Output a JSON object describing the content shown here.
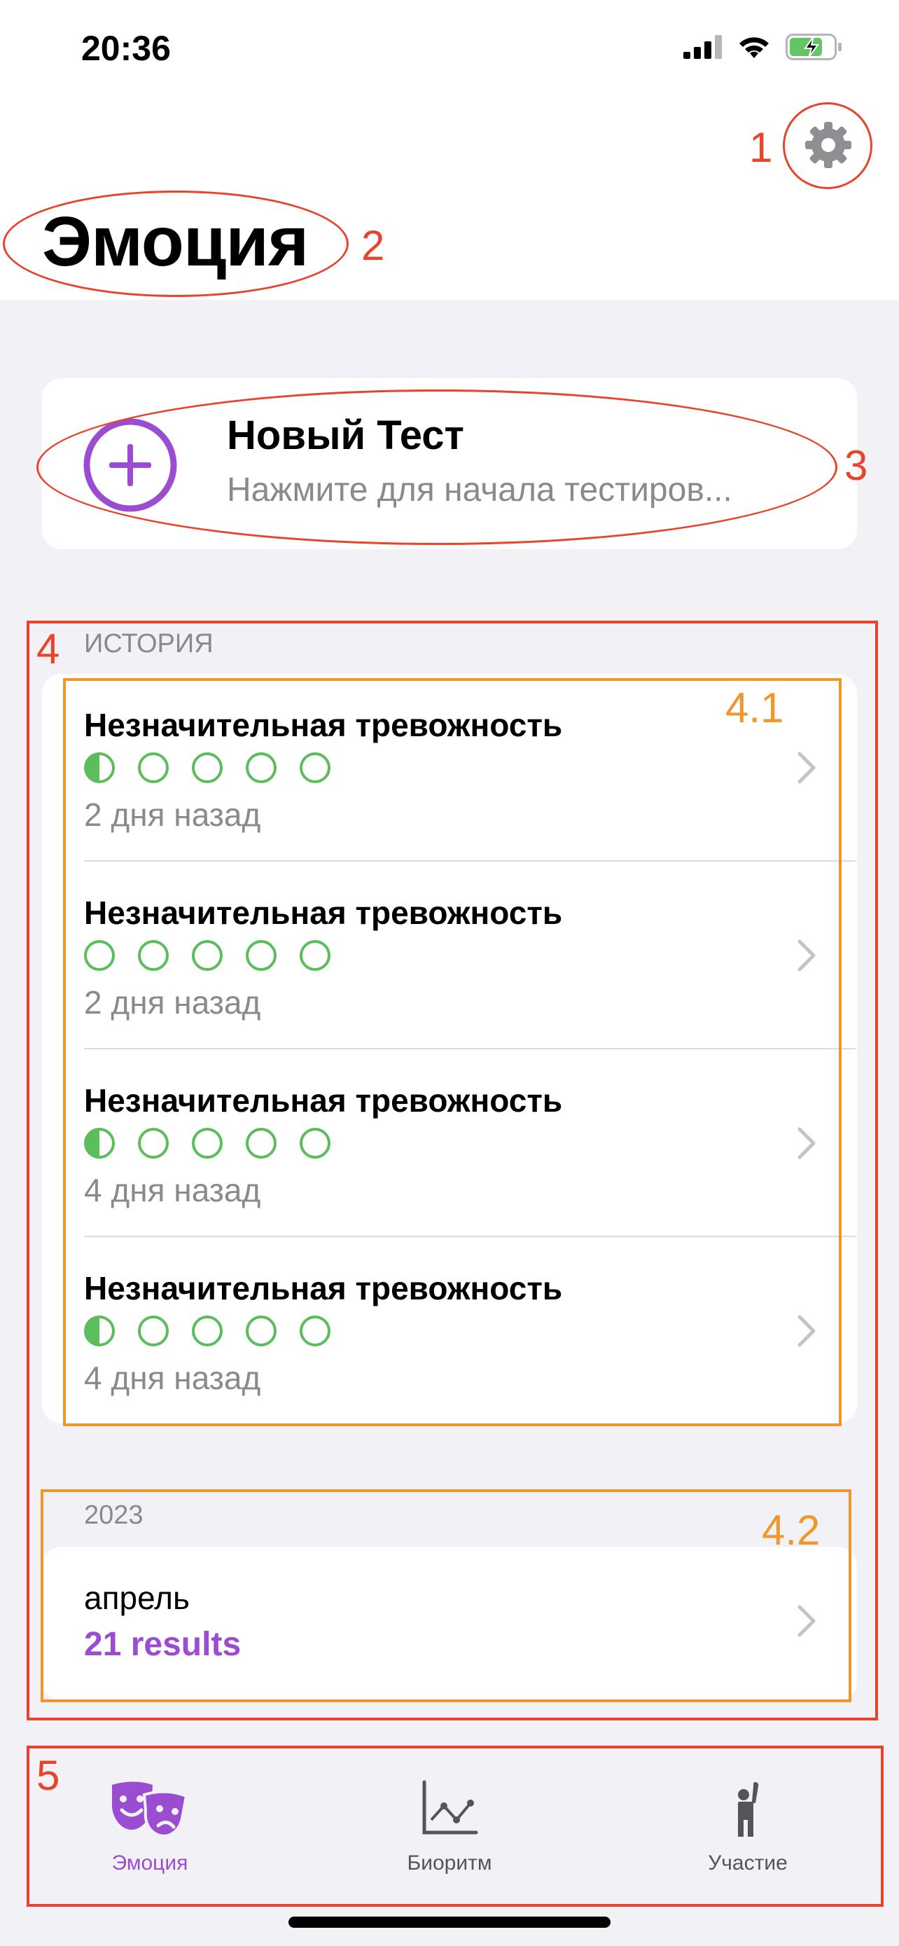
{
  "status_bar": {
    "time": "20:36"
  },
  "header": {
    "title": "Эмоция",
    "settings_icon": "gear-icon"
  },
  "new_test": {
    "title": "Новый Тест",
    "subtitle": "Нажмите для начала тестиров...",
    "icon": "plus-circle-icon",
    "accent": "#9a4dd1"
  },
  "history": {
    "label": "ИСТОРИЯ",
    "items": [
      {
        "title": "Незначительная тревожность",
        "time": "2 дня назад",
        "level": 0.5
      },
      {
        "title": "Незначительная тревожность",
        "time": "2 дня назад",
        "level": 0
      },
      {
        "title": "Незначительная тревожность",
        "time": "4 дня назад",
        "level": 0.5
      },
      {
        "title": "Незначительная тревожность",
        "time": "4 дня назад",
        "level": 0.5
      }
    ]
  },
  "archive": {
    "year": "2023",
    "month": "апрель",
    "count": "21 results"
  },
  "tabbar": {
    "tabs": [
      {
        "label": "Эмоция",
        "icon": "theater-masks-icon",
        "active": true
      },
      {
        "label": "Биоритм",
        "icon": "line-chart-icon",
        "active": false
      },
      {
        "label": "Участие",
        "icon": "person-raising-hand-icon",
        "active": false
      }
    ]
  },
  "annotations": {
    "a1": "1",
    "a2": "2",
    "a3": "3",
    "a4": "4",
    "a41": "4.1",
    "a42": "4.2",
    "a5": "5"
  },
  "colors": {
    "annotation_red": "#e8432b",
    "annotation_orange": "#f0962a",
    "level_green": "#5cbd5c"
  }
}
